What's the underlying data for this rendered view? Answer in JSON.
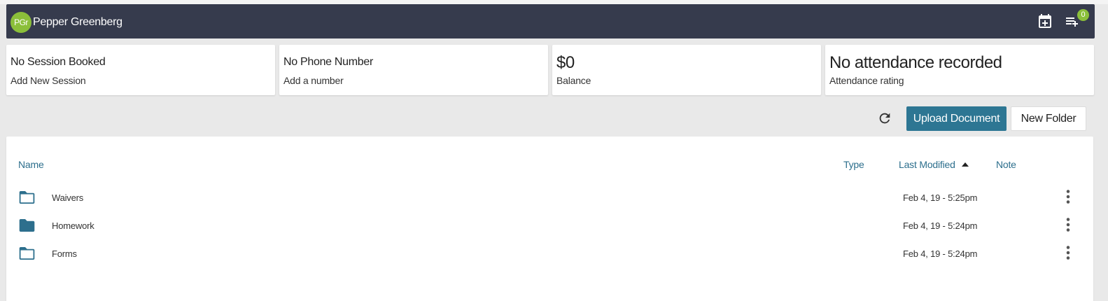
{
  "header": {
    "avatar_initials": "PGr",
    "username": "Pepper Greenberg",
    "notification_count": "0",
    "icons": [
      "calendar-add-icon",
      "playlist-add-icon"
    ]
  },
  "cards": [
    {
      "main": "No Session Booked",
      "sub": "Add New Session"
    },
    {
      "main": "No Phone Number",
      "sub": "Add a number"
    },
    {
      "main": "$0",
      "sub": "Balance"
    },
    {
      "main": "No attendance recorded",
      "sub": "Attendance rating"
    }
  ],
  "toolbar": {
    "refresh_icon": "refresh-icon",
    "upload_label": "Upload Document",
    "new_folder_label": "New Folder"
  },
  "table": {
    "columns": {
      "name": "Name",
      "type": "Type",
      "last_modified": "Last Modified",
      "note": "Note"
    },
    "sort": {
      "column": "last_modified",
      "direction": "ascending"
    },
    "rows": [
      {
        "name": "Waivers",
        "type": "",
        "last_modified": "Feb 4, 19 - 5:25pm",
        "note": "",
        "icon": "folder-outline-icon"
      },
      {
        "name": "Homework",
        "type": "",
        "last_modified": "Feb 4, 19 - 5:24pm",
        "note": "",
        "icon": "folder-filled-icon"
      },
      {
        "name": "Forms",
        "type": "",
        "last_modified": "Feb 4, 19 - 5:24pm",
        "note": "",
        "icon": "folder-outline-icon"
      }
    ]
  },
  "colors": {
    "header_bg": "#363b4d",
    "accent": "#2d7693",
    "avatar_bg": "#8bbf3a",
    "link": "#2d6f8d"
  }
}
